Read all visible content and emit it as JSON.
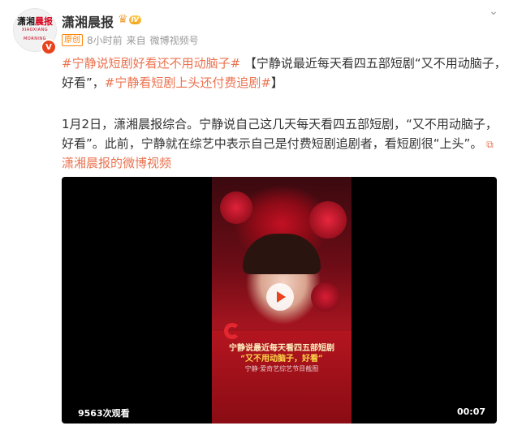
{
  "post": {
    "author": "潇湘晨报",
    "avatar_logo": {
      "part1": "潇湘",
      "part2": "晨报",
      "sub": "XIAOXIANG MORNING"
    },
    "verified_badge": "V",
    "member_level": "IV",
    "original_badge": "原创",
    "time": "8小时前",
    "source_prefix": "来自",
    "source": "微博视频号",
    "more_icon": "chevron-down-icon"
  },
  "content": {
    "line1_tag": "#宁静说短剧好看还不用动脑子#",
    "line1_text": "【宁静说最近每天看四五部短剧“又不用动脑子，",
    "line2_text_a": "好看”，",
    "line2_tag": "#宁静看短剧上头还付费追剧#",
    "line2_text_b": "】",
    "para_line1": "1月2日，潇湘晨报综合。宁静说自己这几天每天看四五部短剧，“又不用动脑子，",
    "para_line2": "好看”。此前，宁静就在综艺中表示自己是付费短剧追剧者，看短剧很“上头”。",
    "link_icon": "link-icon",
    "video_link": "潇湘晨报的微博视频"
  },
  "video": {
    "caption_line1": "宁静说最近每天看四五部短剧",
    "caption_line2": "“又不用动脑子，好看”",
    "caption_line3": "宁静·爱奇艺综艺节目截图",
    "views": "9563次观看",
    "duration": "00:07"
  },
  "colors": {
    "accent": "#eb7350",
    "text": "#333333",
    "meta": "#999999",
    "video_bg": "#000000"
  }
}
